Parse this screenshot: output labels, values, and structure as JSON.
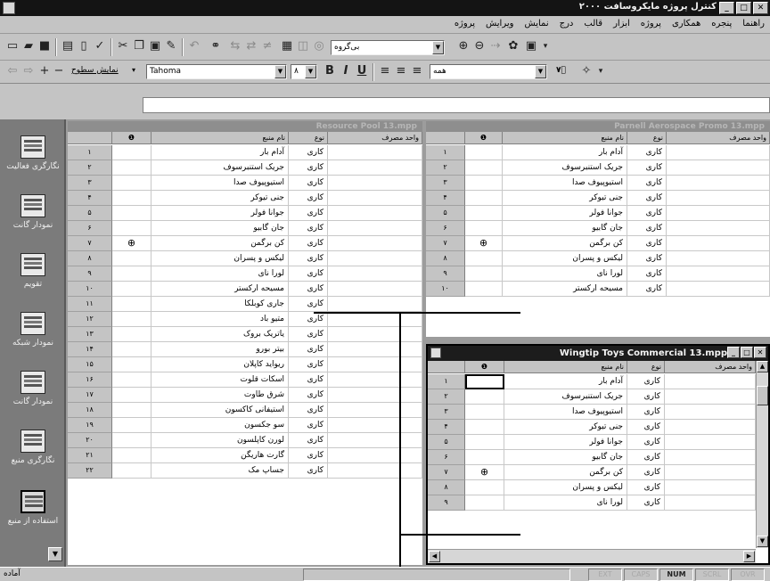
{
  "window": {
    "title": "کنترل پروژه مایکروسافت ۲۰۰۰",
    "buttons": [
      "_",
      "□",
      "✕"
    ]
  },
  "menu": [
    "پروژه",
    "ویرایش",
    "نمایش",
    "درج",
    "قالب",
    "ابزار",
    "پروژه",
    "همکاری",
    "پنجره",
    "راهنما"
  ],
  "toolbar1": {
    "group_combo": "بی‌گروه",
    "zoom_label": "۰"
  },
  "toolbar2": {
    "outline_label": "نمایش سطوح",
    "font": "Tahoma",
    "font_size": "۸",
    "filter": "همه",
    "size_btn": "۷ۢ"
  },
  "viewbar": {
    "items": [
      "نگارگری فعالیت",
      "نمودار گانت",
      "تقویم",
      "نمودار شبکه",
      "نمودار گانت",
      "نگارگری منبع",
      "استفاده از منبع"
    ]
  },
  "columns": {
    "info": "❶",
    "name": "نام منبع",
    "type": "نوع",
    "material": "واحد مصرف"
  },
  "pane_left": {
    "title": "Resource Pool 13.mpp",
    "ids": [
      "۱",
      "۲",
      "۳",
      "۴",
      "۵",
      "۶",
      "۷",
      "۸",
      "۹",
      "۱۰",
      "۱۱",
      "۱۲",
      "۱۳",
      "۱۴",
      "۱۵",
      "۱۶",
      "۱۷",
      "۱۸",
      "۱۹",
      "۲۰",
      "۲۱",
      "۲۲"
    ],
    "names": [
      "آدام بار",
      "جریک استنبرسوف",
      "استیوپیوف صدا",
      "جنی تیوکر",
      "جوانا فولر",
      "جان گابیو",
      "کن برگمن",
      "لیکس و پسران",
      "لورا نای",
      "مسیحه ارکستر",
      "جاری کوبلکا",
      "متیو باد",
      "یاتریک بروک",
      "بیتر بورو",
      "ریواید کاپلان",
      "اسکات قلوت",
      "شرق طاوت",
      "استیفانی کاکسون",
      "سو جکسون",
      "لورن کاپلسون",
      "گارت هاریگن",
      "جساپ مک"
    ],
    "types": [
      "کاری",
      "کاری",
      "کاری",
      "کاری",
      "کاری",
      "کاری",
      "کاری",
      "کاری",
      "کاری",
      "کاری",
      "کاری",
      "کاری",
      "کاری",
      "کاری",
      "کاری",
      "کاری",
      "کاری",
      "کاری",
      "کاری",
      "کاری",
      "کاری",
      "کاری"
    ]
  },
  "pane_right": {
    "title": "Parnell Aerospace Promo 13.mpp",
    "ids": [
      "۱",
      "۲",
      "۳",
      "۴",
      "۵",
      "۶",
      "۷",
      "۸",
      "۹",
      "۱۰"
    ],
    "names": [
      "آدام بار",
      "جریک استنبرسوف",
      "استیوپیوف صدا",
      "جنی تیوکر",
      "جوانا فولر",
      "جان گابیو",
      "کن برگمن",
      "لیکس و پسران",
      "لورا نای",
      "مسیحه ارکستر"
    ],
    "types": [
      "کاری",
      "کاری",
      "کاری",
      "کاری",
      "کاری",
      "کاری",
      "کاری",
      "کاری",
      "کاری",
      "کاری"
    ]
  },
  "pane_inner": {
    "title": "Wingtip Toys Commercial 13.mpp",
    "ids": [
      "۱",
      "۲",
      "۳",
      "۴",
      "۵",
      "۶",
      "۷",
      "۸",
      "۹"
    ],
    "names": [
      "آدام بار",
      "جریک استنبرسوف",
      "استیوپیوف صدا",
      "جنی تیوکر",
      "جوانا فولر",
      "جان گابیو",
      "کن برگمن",
      "لیکس و پسران",
      "لورا نای"
    ],
    "types": [
      "کاری",
      "کاری",
      "کاری",
      "کاری",
      "کاری",
      "کاری",
      "کاری",
      "کاری",
      "کاری"
    ]
  },
  "status": {
    "text": "آماده",
    "indicators": [
      "EXT",
      "CAPS",
      "NUM",
      "SCRL",
      "OVR"
    ],
    "active": "NUM"
  },
  "colors": {
    "titlebar": "#141414",
    "face": "#c4c4c4",
    "viewbar": "#7b7b7b"
  }
}
